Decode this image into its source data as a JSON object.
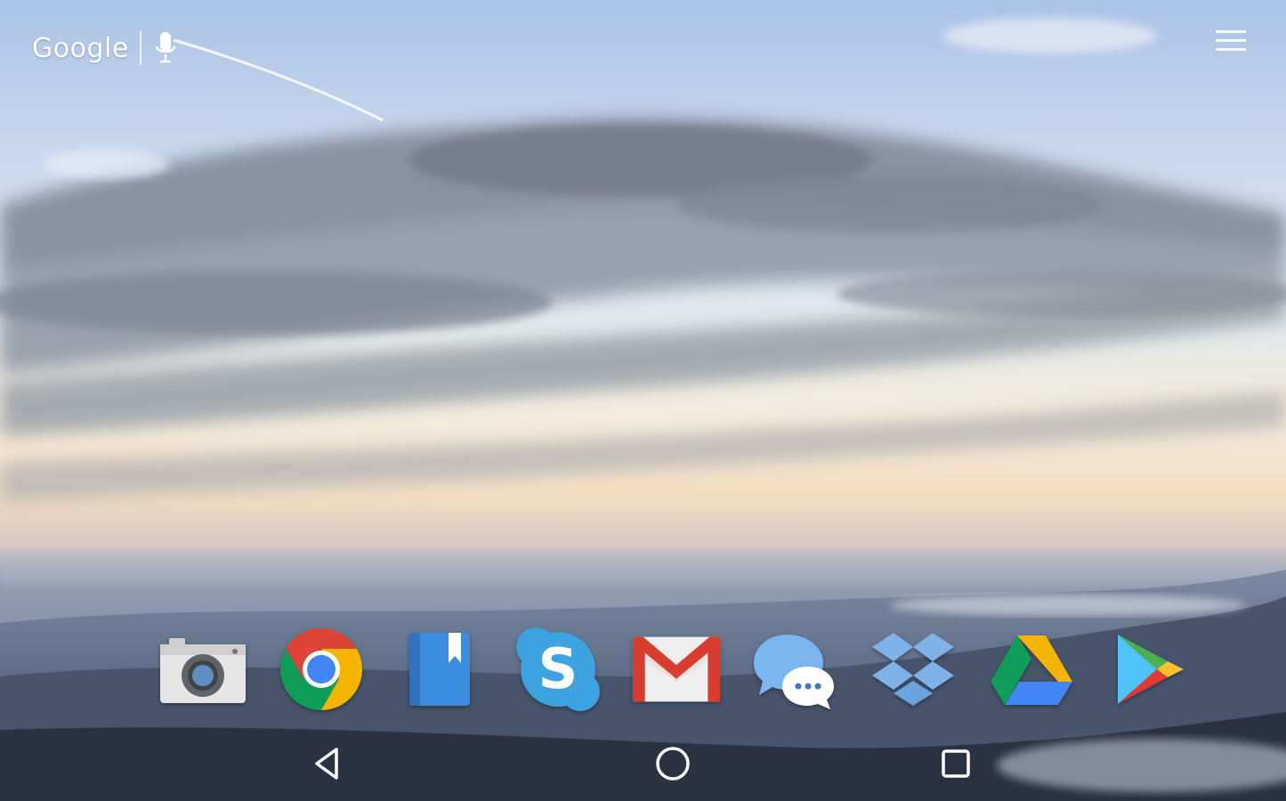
{
  "search_widget": {
    "logo_text": "Google",
    "mic_icon": "mic-icon"
  },
  "menu": {
    "icon": "hamburger-menu-icon"
  },
  "dock": {
    "apps": [
      {
        "app": "camera",
        "icon": "camera-icon"
      },
      {
        "app": "chrome",
        "icon": "chrome-icon"
      },
      {
        "app": "books",
        "icon": "book-icon"
      },
      {
        "app": "skype",
        "icon": "skype-icon",
        "glyph": "S"
      },
      {
        "app": "gmail",
        "icon": "gmail-icon"
      },
      {
        "app": "messenger",
        "icon": "chat-bubbles-icon"
      },
      {
        "app": "dropbox",
        "icon": "dropbox-icon"
      },
      {
        "app": "drive",
        "icon": "drive-icon"
      },
      {
        "app": "play-store",
        "icon": "play-store-icon"
      }
    ]
  },
  "navbar": {
    "buttons": [
      {
        "role": "back",
        "icon": "back-triangle-icon"
      },
      {
        "role": "home",
        "icon": "home-circle-icon"
      },
      {
        "role": "recents",
        "icon": "recents-square-icon"
      }
    ]
  },
  "colors": {
    "google_red": "#db4437",
    "google_yellow": "#f4b400",
    "google_green": "#0f9d58",
    "google_blue": "#4285f4",
    "skype_blue": "#3da2e0",
    "dropbox_blue": "#7fb2e8"
  }
}
